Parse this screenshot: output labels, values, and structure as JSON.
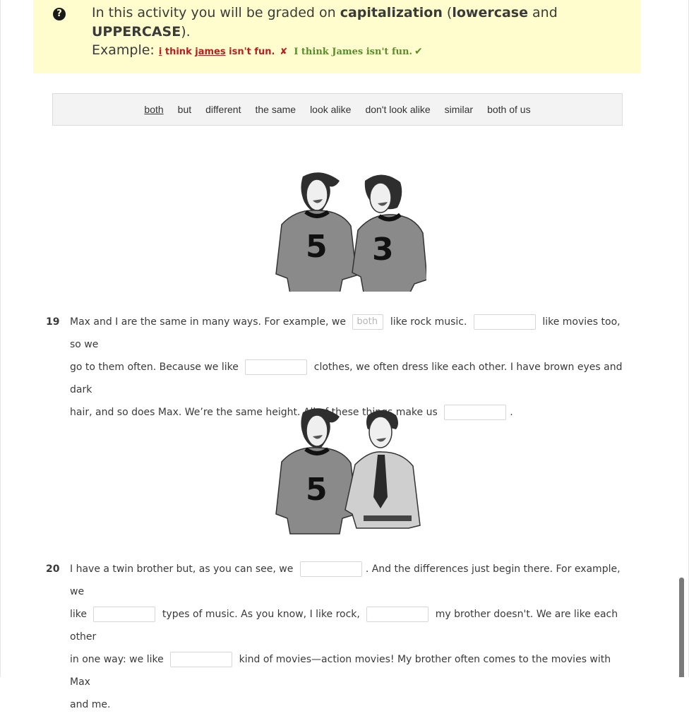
{
  "instructions": {
    "icon": "question-circle-icon",
    "text_parts": [
      {
        "text": "In this activity you will be graded on ",
        "bold": false
      },
      {
        "text": "capitalization",
        "bold": true
      },
      {
        "text": " (",
        "bold": false
      },
      {
        "text": "lowercase",
        "bold": false
      },
      {
        "text": " and ",
        "bold": false
      },
      {
        "text": "UPPERCASE",
        "bold": true
      },
      {
        "text": ").",
        "bold": false
      }
    ],
    "line1_a": "In this activity you will be graded on ",
    "line1_b": "capitalization",
    "line1_c": " (",
    "line1_d": "lowercase",
    "line1_e": " and",
    "line2_a": "UPPERCASE",
    "line2_b": ").",
    "example_label": "Example:",
    "wrong_i": "i",
    "wrong_mid": " think ",
    "wrong_james": "james",
    "wrong_end": " isn't fun.",
    "wrong_mark": "✘",
    "correct": "I think James isn't fun.",
    "correct_mark": "✔",
    "colors": {
      "banner_bg": "#fffdcd",
      "wrong": "#b22222",
      "correct": "#5b8c2a"
    }
  },
  "word_bank": [
    {
      "label": "both",
      "used": true
    },
    {
      "label": "but",
      "used": false
    },
    {
      "label": "different",
      "used": false
    },
    {
      "label": "the same",
      "used": false
    },
    {
      "label": "look alike",
      "used": false
    },
    {
      "label": "don't look alike",
      "used": false
    },
    {
      "label": "similar",
      "used": false
    },
    {
      "label": "both of us",
      "used": false
    }
  ],
  "images": [
    {
      "name": "twins-image",
      "description": "Two identical boys in sweatshirts numbered 5 and 3",
      "jersey_numbers": [
        "5",
        "3"
      ]
    },
    {
      "name": "brothers-image",
      "description": "Boy in sweatshirt numbered 5 next to boy in shirt and tie",
      "jersey_numbers": [
        "5"
      ]
    }
  ],
  "exercises": [
    {
      "number": "19",
      "t1": "Max and I are the same in many ways. For example, we",
      "b1": "both",
      "t2": "like rock music.",
      "b2": "",
      "t3": "like movies too, so we",
      "t4": "go to them often. Because we like",
      "b3": "",
      "t5": "clothes, we often dress like each other. I have brown eyes and dark",
      "t6": "hair, and so does Max. We’re the same height. All of these things make us",
      "b4": "",
      "t7": "."
    },
    {
      "number": "20",
      "t1": "I have a twin brother but, as you can see, we",
      "b1": "",
      "t2": ". And the differences just begin there. For example, we",
      "t3": "like",
      "b2": "",
      "t4": "types of music. As you know, I like rock,",
      "b3": "",
      "t5": "my brother doesn't. We are like each other",
      "t6": "in one way: we like",
      "b4": "",
      "t7": "kind of movies—action movies! My brother often comes to the movies with Max",
      "t8": "and me."
    }
  ]
}
